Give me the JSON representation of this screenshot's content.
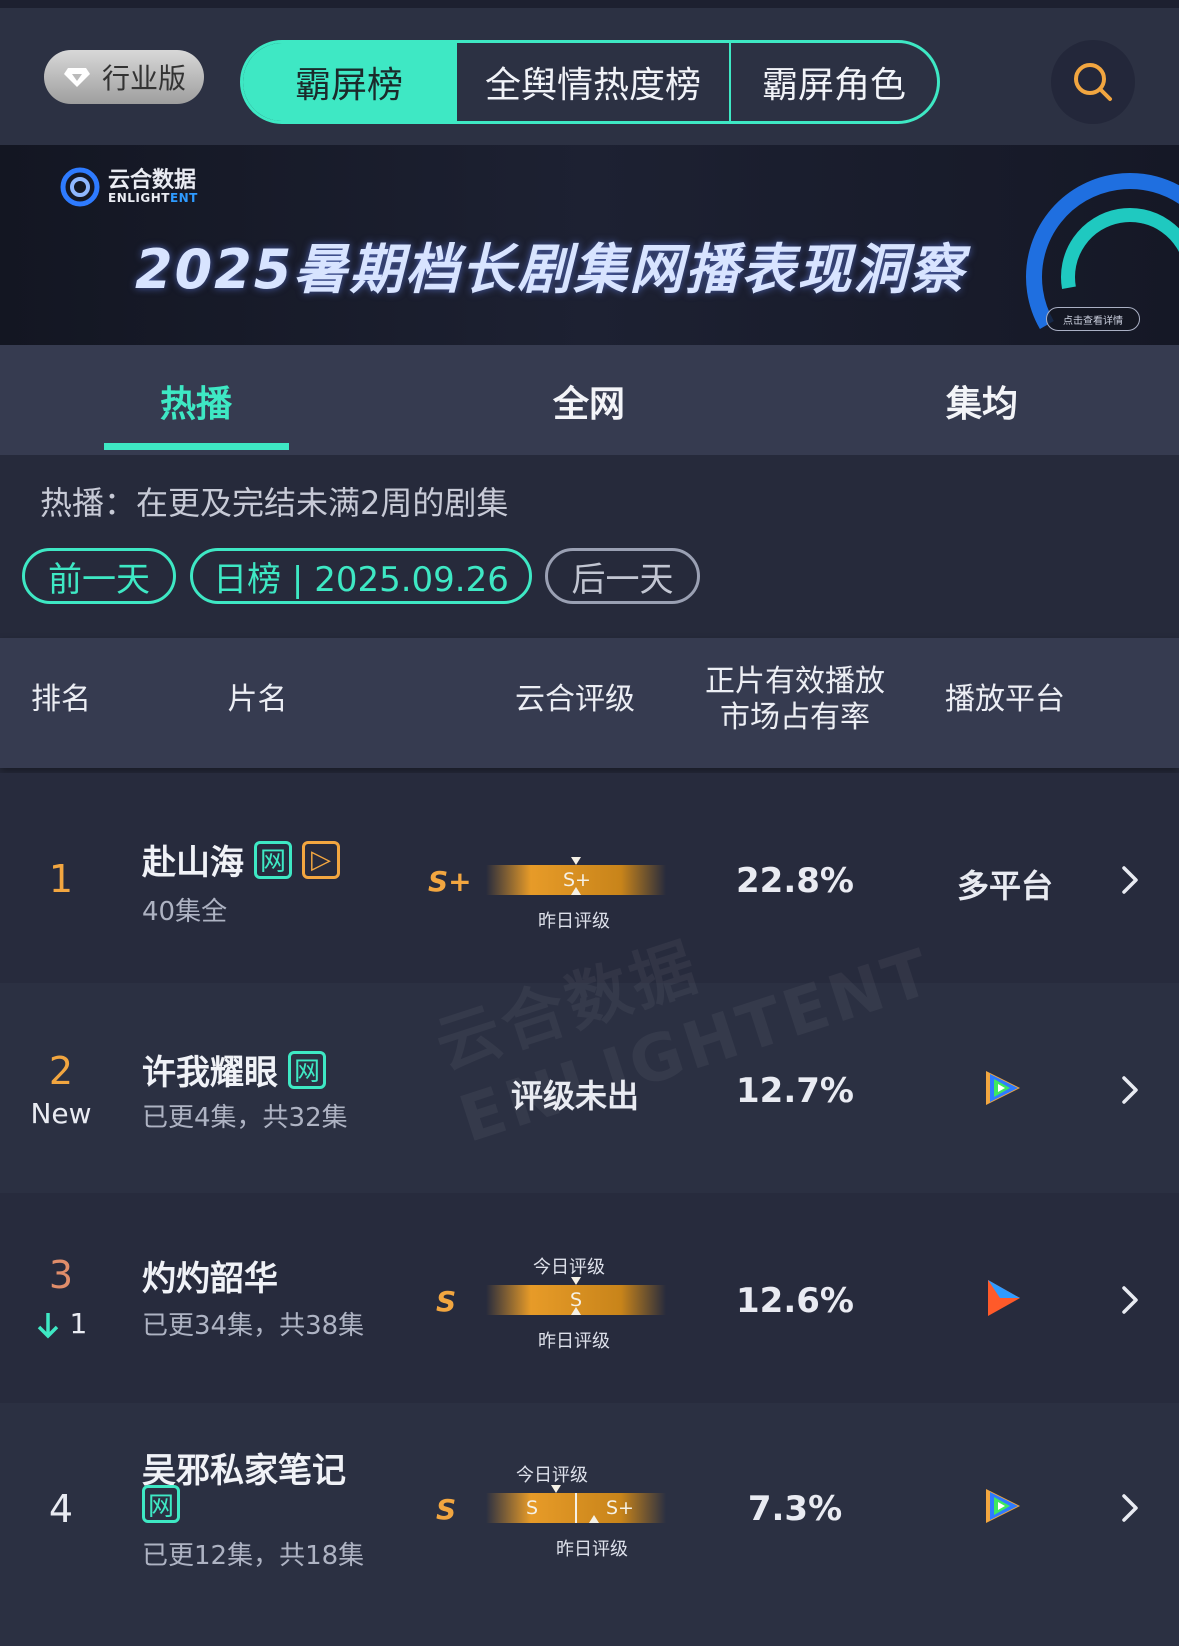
{
  "header": {
    "badge_label": "行业版",
    "tabs": [
      {
        "label": "霸屏榜",
        "active": true
      },
      {
        "label": "全舆情热度榜",
        "active": false
      },
      {
        "label": "霸屏角色",
        "active": false
      }
    ],
    "accent_color": "#3ee8c4"
  },
  "banner": {
    "brand_cn": "云合数据",
    "brand_en_1": "ENLIGHT",
    "brand_en_2": "ENT",
    "title": "2025暑期档长剧集网播表现洞察",
    "link_label": "点击查看详情"
  },
  "subtabs": [
    {
      "label": "热播",
      "active": true
    },
    {
      "label": "全网",
      "active": false
    },
    {
      "label": "集均",
      "active": false
    }
  ],
  "description": "热播：在更及完结未满2周的剧集",
  "date_nav": {
    "prev": "前一天",
    "current": "日榜 | 2025.09.26",
    "next": "后一天"
  },
  "table": {
    "headers": {
      "rank": "排名",
      "name": "片名",
      "rating": "云合评级",
      "share_line1": "正片有效播放",
      "share_line2": "市场占有率",
      "platform": "播放平台"
    },
    "today_caption": "今日评级",
    "yesterday_caption": "昨日评级",
    "rows": [
      {
        "rank": "1",
        "rank_color": "#f2a640",
        "rank_sub": "",
        "title": "赴山海",
        "tags": [
          "网",
          "▷"
        ],
        "episodes": "40集全",
        "grade": "S+",
        "bar_label": "S+",
        "share": "22.8%",
        "platform": "多平台",
        "platform_icon": ""
      },
      {
        "rank": "2",
        "rank_color": "#f2a640",
        "rank_sub": "New",
        "title": "许我耀眼",
        "tags": [
          "网"
        ],
        "episodes": "已更4集，共32集",
        "no_rating": "评级未出",
        "share": "12.7%",
        "platform_icon": "tencent-video-icon"
      },
      {
        "rank": "3",
        "rank_color": "#e08d6a",
        "rank_sub": "1",
        "rank_change": "down",
        "title": "灼灼韶华",
        "tags": [],
        "episodes": "已更34集，共38集",
        "grade": "S",
        "bar_label": "S",
        "share": "12.6%",
        "platform_icon": "youku-icon"
      },
      {
        "rank": "4",
        "rank_color": "#e9ebf2",
        "rank_sub": "",
        "title": "吴邪私家笔记",
        "tags": [
          "网"
        ],
        "episodes": "已更12集，共18集",
        "grade": "S",
        "bar_left": "S",
        "bar_right": "S+",
        "share": "7.3%",
        "platform_icon": "tencent-video-icon"
      }
    ]
  },
  "watermark": "云合数据 ENLIGHTENT"
}
